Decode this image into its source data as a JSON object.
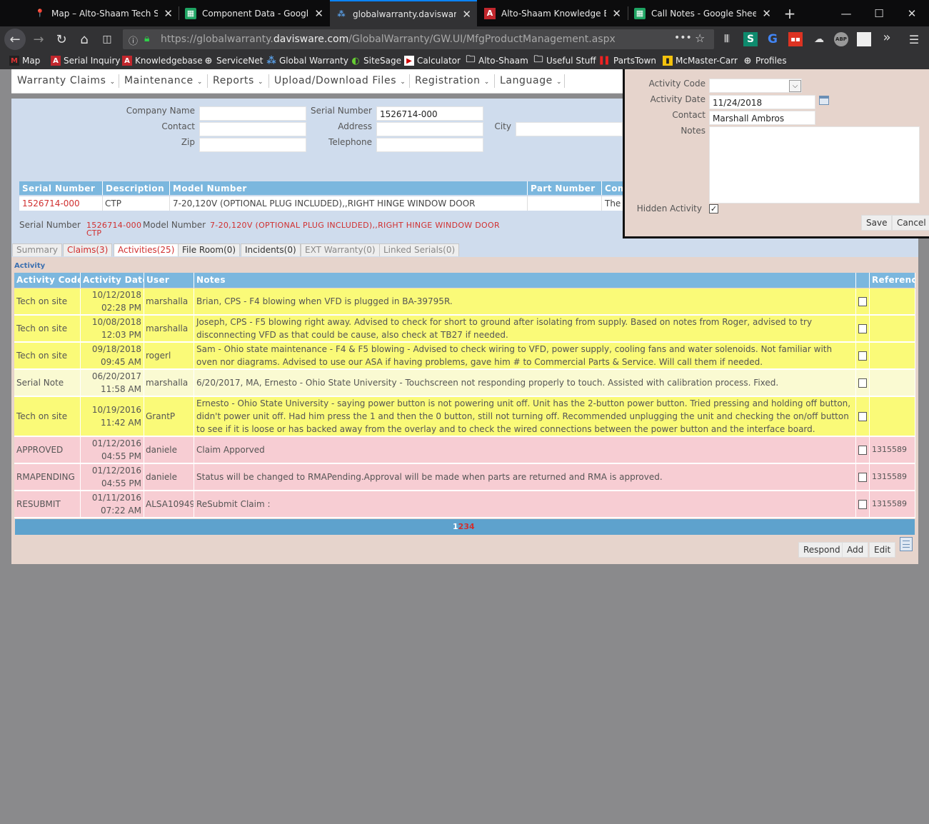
{
  "browser": {
    "tabs": [
      {
        "title": "Map – Alto-Shaam Tech Ser",
        "icon": "map-pin-icon"
      },
      {
        "title": "Component Data - Google S",
        "icon": "sheets-icon"
      },
      {
        "title": "globalwarranty.davisware.cc",
        "icon": "davisware-icon"
      },
      {
        "title": "Alto-Shaam Knowledge Bas",
        "icon": "alto-shaam-icon"
      },
      {
        "title": "Call Notes - Google Sheets",
        "icon": "sheets-icon"
      }
    ],
    "new_tab": "+",
    "url_prefix": "https://globalwarranty.",
    "url_domain": "davisware.com",
    "url_path": "/GlobalWarranty/GW.UI/MfgProductManagement.aspx",
    "page_actions": "•••",
    "badge_s": "1",
    "badge_ext": "2",
    "overflow": "»",
    "bookmarks": [
      {
        "label": "Map"
      },
      {
        "label": "Serial Inquiry"
      },
      {
        "label": "Knowledgebase"
      },
      {
        "label": "ServiceNet"
      },
      {
        "label": "Global Warranty"
      },
      {
        "label": "SiteSage"
      },
      {
        "label": "Calculator"
      },
      {
        "label": "Alto-Shaam"
      },
      {
        "label": "Useful Stuff"
      },
      {
        "label": "PartsTown"
      },
      {
        "label": "McMaster-Carr"
      },
      {
        "label": "Profiles"
      }
    ]
  },
  "menu": {
    "items": [
      "Warranty Claims",
      "Maintenance",
      "Reports",
      "Upload/Download Files",
      "Registration",
      "Language"
    ]
  },
  "customer": {
    "company_name_label": "Company Name",
    "company_name": "",
    "contact_label": "Contact",
    "contact": "",
    "zip_label": "Zip",
    "zip": "",
    "serial_label": "Serial Number",
    "serial": "1526714-000",
    "address_label": "Address",
    "address": "",
    "telephone_label": "Telephone",
    "telephone": "",
    "city_label": "City",
    "city": ""
  },
  "serial_table": {
    "headers": [
      "Serial Number",
      "Description",
      "Model Number",
      "Part Number",
      "Com"
    ],
    "row": [
      "1526714-000",
      "CTP",
      "7-20,120V (OPTIONAL PLUG INCLUDED),,RIGHT HINGE WINDOW DOOR",
      "",
      "The"
    ]
  },
  "summary_line": {
    "serial_label": "Serial Number",
    "serial": "1526714-000",
    "model_label": "Model Number",
    "model": "7-20,120V (OPTIONAL PLUG INCLUDED),,RIGHT HINGE WINDOW DOOR",
    "desc": "CTP"
  },
  "tabs": [
    {
      "label": "Summary"
    },
    {
      "label": "Claims(3)"
    },
    {
      "label": "Activities(25)"
    },
    {
      "label": "File Room(0)"
    },
    {
      "label": "Incidents(0)"
    },
    {
      "label": "EXT Warranty(0)"
    },
    {
      "label": "Linked Serials(0)"
    }
  ],
  "activity": {
    "section_label": "Activity",
    "headers": [
      "Activity Code",
      "Activity Date",
      "User",
      "Notes",
      "",
      "Reference"
    ],
    "rows": [
      {
        "code": "Tech on site",
        "date": "10/12/2018",
        "time": "02:28 PM",
        "user": "marshalla",
        "notes": "Brian, CPS - F4 blowing when VFD is plugged in BA-39795R.",
        "ref": "",
        "bg": "#fafa78"
      },
      {
        "code": "Tech on site",
        "date": "10/08/2018",
        "time": "12:03 PM",
        "user": "marshalla",
        "notes": "Joseph, CPS - F5 blowing right away. Advised to check for short to ground after isolating from supply. Based on notes from Roger, advised to try disconnecting VFD as that could be cause, also check at TB27 if needed.",
        "ref": "",
        "bg": "#fafa78"
      },
      {
        "code": "Tech on site",
        "date": "09/18/2018",
        "time": "09:45 AM",
        "user": "rogerl",
        "notes": "Sam - Ohio state maintenance - F4 & F5 blowing - Advised to check wiring to VFD, power supply, cooling fans and water solenoids. Not familiar with oven nor diagrams. Advised to use our ASA if having problems, gave him # to Commercial Parts & Service. Will call them if needed.",
        "ref": "",
        "bg": "#fafa78"
      },
      {
        "code": "Serial Note",
        "date": "06/20/2017",
        "time": "11:58 AM",
        "user": "marshalla",
        "notes": "6/20/2017, MA, Ernesto - Ohio State University - Touchscreen not responding properly to touch. Assisted with calibration process. Fixed.",
        "ref": "",
        "bg": "#fafad2"
      },
      {
        "code": "Tech on site",
        "date": "10/19/2016",
        "time": "11:42 AM",
        "user": "GrantP",
        "notes": "Ernesto - Ohio State University - saying power button is not powering unit off. Unit has the 2-button power button. Tried pressing and holding off button, didn't power unit off. Had him press the 1 and then the 0 button, still not turning off. Recommended unplugging the unit and checking the on/off button to see if it is loose or has backed away from the overlay and to check the wired connections between the power button and the interface board.",
        "ref": "",
        "bg": "#fafa78"
      },
      {
        "code": "APPROVED",
        "date": "01/12/2016",
        "time": "04:55 PM",
        "user": "daniele",
        "notes": "Claim Apporved",
        "ref": "1315589",
        "bg": "#f7cdd3"
      },
      {
        "code": "RMAPENDING",
        "date": "01/12/2016",
        "time": "04:55 PM",
        "user": "daniele",
        "notes": "Status will be changed to RMAPending.Approval will be made when parts are returned and RMA is approved.",
        "ref": "1315589",
        "bg": "#f7cdd3"
      },
      {
        "code": "RESUBMIT",
        "date": "01/11/2016",
        "time": "07:22 AM",
        "user": "ALSA10949",
        "notes": "ReSubmit Claim :",
        "ref": "1315589",
        "bg": "#f7cdd3"
      }
    ],
    "pages": [
      "1",
      "2",
      "3",
      "4"
    ]
  },
  "actions": {
    "respond": "Respond",
    "add": "Add",
    "edit": "Edit"
  },
  "popup": {
    "activity_code_label": "Activity Code",
    "activity_code": "",
    "activity_date_label": "Activity Date",
    "activity_date": "11/24/2018",
    "contact_label": "Contact",
    "contact": "Marshall Ambros",
    "notes_label": "Notes",
    "notes": "",
    "hidden_label": "Hidden Activity",
    "hidden_checked": "✓",
    "save": "Save",
    "cancel": "Cancel"
  },
  "colors": {
    "accent": "#7bb7de",
    "link_red": "#d03030",
    "yellow_row": "#fafa78",
    "pink_row": "#f7cdd3"
  }
}
